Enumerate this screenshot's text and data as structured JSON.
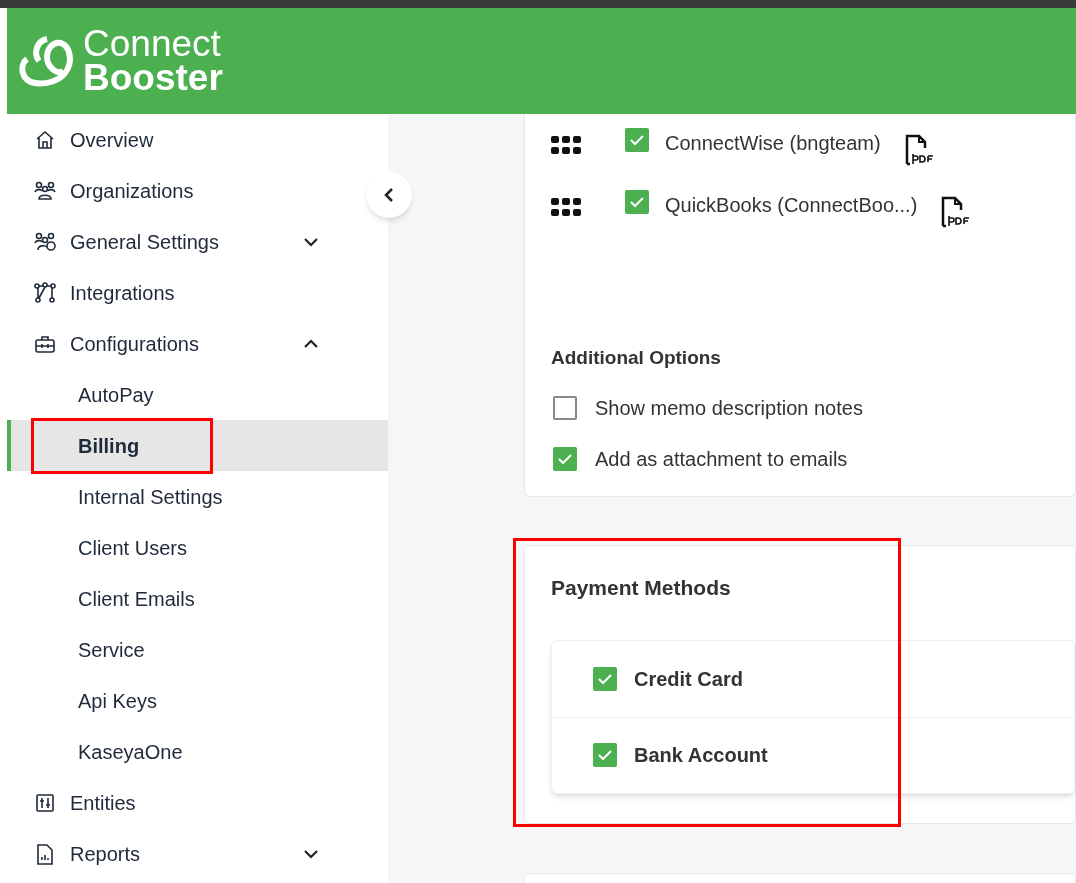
{
  "header": {
    "logo_line_1": "Connect",
    "logo_line_2": "Booster"
  },
  "sidebar": {
    "items": [
      {
        "label": "Overview",
        "selected": false
      },
      {
        "label": "Organizations",
        "selected": false
      },
      {
        "label": "General Settings",
        "selected": false,
        "expanded": false
      },
      {
        "label": "Integrations",
        "selected": false
      },
      {
        "label": "Configurations",
        "selected": false,
        "expanded": true,
        "children": [
          {
            "label": "AutoPay",
            "selected": false,
            "highlighted": false
          },
          {
            "label": "Billing",
            "selected": true,
            "highlighted": true
          },
          {
            "label": "Internal Settings",
            "selected": false,
            "highlighted": false
          },
          {
            "label": "Client Users",
            "selected": false,
            "highlighted": false
          },
          {
            "label": "Client Emails",
            "selected": false,
            "highlighted": false
          },
          {
            "label": "Service",
            "selected": false,
            "highlighted": false
          },
          {
            "label": "Api Keys",
            "selected": false,
            "highlighted": false
          },
          {
            "label": "KaseyaOne",
            "selected": false,
            "highlighted": false
          }
        ]
      },
      {
        "label": "Entities",
        "selected": false
      },
      {
        "label": "Reports",
        "selected": false,
        "expanded": false
      }
    ]
  },
  "integrations": [
    {
      "label": "ConnectWise (bngteam)",
      "checked": true
    },
    {
      "label": "QuickBooks (ConnectBoo...)",
      "checked": true
    }
  ],
  "additional_options": {
    "title": "Additional Options",
    "options": [
      {
        "label": "Show memo description notes",
        "checked": false
      },
      {
        "label": "Add as attachment to emails",
        "checked": true
      }
    ]
  },
  "payment_methods": {
    "title": "Payment Methods",
    "highlighted": true,
    "methods": [
      {
        "label": "Credit Card",
        "checked": true
      },
      {
        "label": "Bank Account",
        "checked": true
      }
    ]
  }
}
